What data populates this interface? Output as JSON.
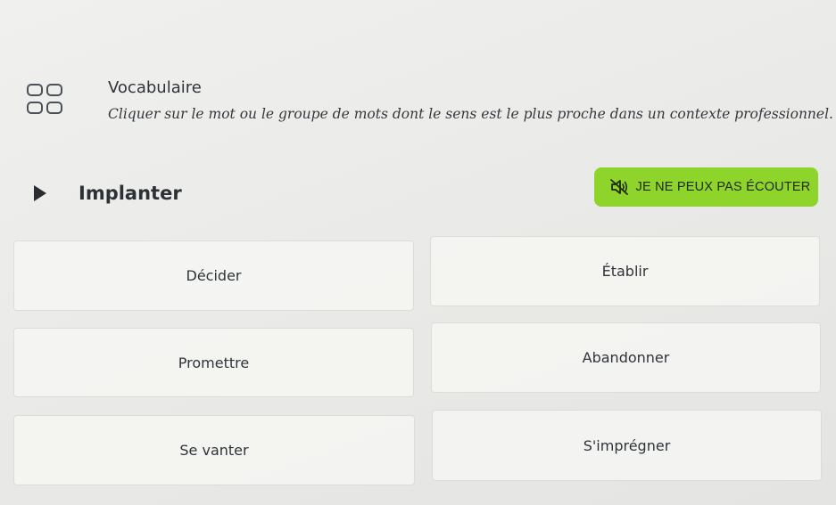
{
  "exercise": {
    "title": "Vocabulaire",
    "instruction": "Cliquer sur le mot ou le groupe de mots dont le sens est le plus proche dans un contexte professionnel.",
    "icon": "grid-icon"
  },
  "question": {
    "word": "Implanter",
    "play_icon": "play-icon"
  },
  "listen_button": {
    "label": "JE NE PEUX PAS ÉCOUTER",
    "icon": "speaker-muted-icon",
    "color": "#8ed42a"
  },
  "options": [
    {
      "label": "Décider"
    },
    {
      "label": "Établir"
    },
    {
      "label": "Promettre"
    },
    {
      "label": "Abandonner"
    },
    {
      "label": "Se vanter"
    },
    {
      "label": "S'imprégner"
    }
  ]
}
